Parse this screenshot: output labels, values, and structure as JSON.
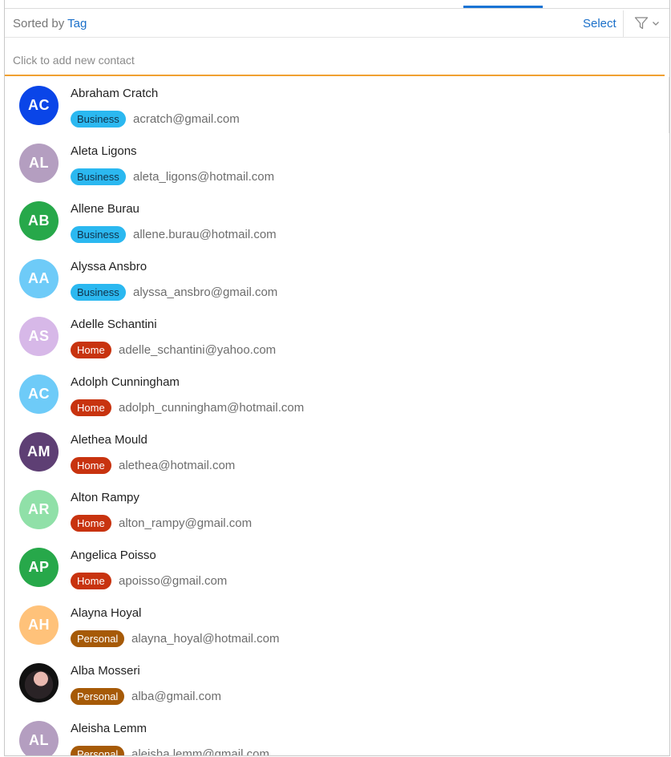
{
  "header": {
    "sorted_prefix": "Sorted by",
    "sorted_field": "Tag",
    "select_label": "Select",
    "filter_icon": "filter-icon",
    "dropdown_icon": "chevron-down-icon"
  },
  "add_contact": {
    "placeholder": "Click to add new contact"
  },
  "colors": {
    "accent": "#1a73d4",
    "add_underline": "#f0a030",
    "business_tag": "#2bb8f0",
    "home_tag": "#c8330f",
    "personal_tag": "#a65a07"
  },
  "contacts": [
    {
      "initials": "AC",
      "name": "Abraham Cratch",
      "tag": "Business",
      "email": "acratch@gmail.com",
      "color": "#0a45e8"
    },
    {
      "initials": "AL",
      "name": "Aleta Ligons",
      "tag": "Business",
      "email": "aleta_ligons@hotmail.com",
      "color": "#b49ec0"
    },
    {
      "initials": "AB",
      "name": "Allene Burau",
      "tag": "Business",
      "email": "allene.burau@hotmail.com",
      "color": "#27a84a"
    },
    {
      "initials": "AA",
      "name": "Alyssa Ansbro",
      "tag": "Business",
      "email": "alyssa_ansbro@gmail.com",
      "color": "#6ecbf8"
    },
    {
      "initials": "AS",
      "name": "Adelle Schantini",
      "tag": "Home",
      "email": "adelle_schantini@yahoo.com",
      "color": "#d7b8e8"
    },
    {
      "initials": "AC",
      "name": "Adolph Cunningham",
      "tag": "Home",
      "email": "adolph_cunningham@hotmail.com",
      "color": "#6ecbf8"
    },
    {
      "initials": "AM",
      "name": "Alethea Mould",
      "tag": "Home",
      "email": "alethea@hotmail.com",
      "color": "#5e3f74"
    },
    {
      "initials": "AR",
      "name": "Alton Rampy",
      "tag": "Home",
      "email": "alton_rampy@gmail.com",
      "color": "#90e0a8"
    },
    {
      "initials": "AP",
      "name": "Angelica Poisso",
      "tag": "Home",
      "email": "apoisso@gmail.com",
      "color": "#27a84a"
    },
    {
      "initials": "AH",
      "name": "Alayna Hoyal",
      "tag": "Personal",
      "email": "alayna_hoyal@hotmail.com",
      "color": "#ffc27a"
    },
    {
      "initials": "",
      "name": "Alba Mosseri",
      "tag": "Personal",
      "email": "alba@gmail.com",
      "color": "#222222",
      "photo": true
    },
    {
      "initials": "AL",
      "name": "Aleisha Lemm",
      "tag": "Personal",
      "email": "aleisha.lemm@gmail.com",
      "color": "#b49ec0"
    }
  ]
}
